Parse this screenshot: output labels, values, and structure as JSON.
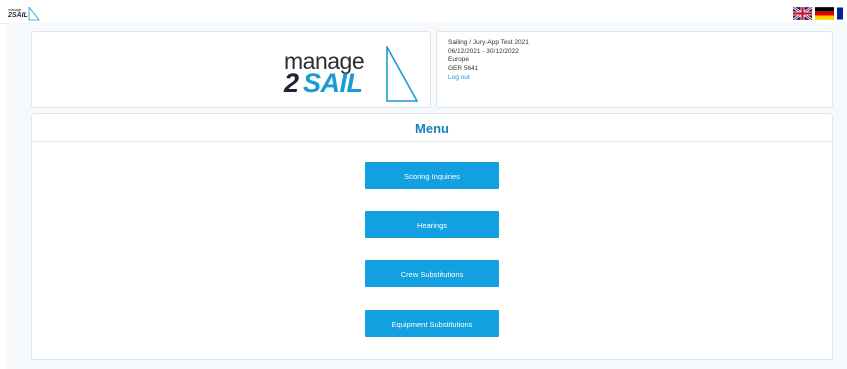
{
  "header": {
    "small_logo": {
      "word1": "manage",
      "word2": "2SAIL"
    },
    "languages": [
      {
        "name": "english",
        "icon": "uk-flag-icon"
      },
      {
        "name": "german",
        "icon": "germany-flag-icon"
      },
      {
        "name": "french",
        "icon": "france-flag-icon"
      }
    ]
  },
  "brand": {
    "manage": "manage",
    "two": "2",
    "sail": "SAIL",
    "colors": {
      "dark": "#1e2232",
      "blue": "#1c9ad6"
    }
  },
  "event_info": {
    "event": "Sailing / Jury-App Test 2021",
    "dates": "06/12/2021 - 30/12/2022",
    "region": "Europe",
    "sail_number": "GER 5641",
    "logout_label": "Log out"
  },
  "menu": {
    "title": "Menu",
    "buttons": [
      {
        "label": "Scoring Inquiries"
      },
      {
        "label": "Hearings"
      },
      {
        "label": "Crew Substitutions"
      },
      {
        "label": "Equipment Substitutions"
      }
    ]
  },
  "colors": {
    "accent": "#12a0e0",
    "title": "#1c80bf",
    "background": "#f6f9fc"
  }
}
